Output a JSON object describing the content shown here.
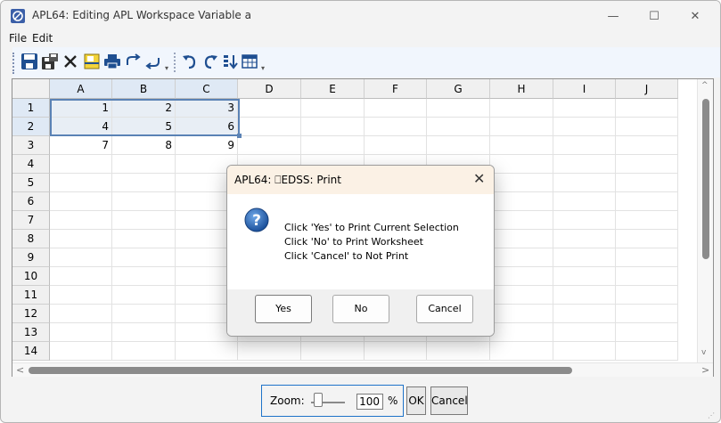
{
  "window": {
    "title": "APL64: Editing APL Workspace Variable a",
    "minimize_glyph": "—",
    "maximize_glyph": "☐",
    "close_glyph": "✕"
  },
  "menu": {
    "items": [
      "File",
      "Edit"
    ]
  },
  "toolbar": {
    "icons": [
      "save-icon",
      "save-as-icon",
      "close-icon",
      "split-icon",
      "print-icon",
      "redo-arrow-icon",
      "undo-arrow-icon",
      "undo-icon",
      "redo-icon",
      "sort-icon",
      "table-icon"
    ]
  },
  "grid": {
    "columns": [
      "A",
      "B",
      "C",
      "D",
      "E",
      "F",
      "G",
      "H",
      "I",
      "J"
    ],
    "rows": [
      "1",
      "2",
      "3",
      "4",
      "5",
      "6",
      "7",
      "8",
      "9",
      "10",
      "11",
      "12",
      "13",
      "14"
    ],
    "cells": [
      [
        "1",
        "2",
        "3"
      ],
      [
        "4",
        "5",
        "6"
      ],
      [
        "7",
        "8",
        "9"
      ]
    ],
    "selection": "A1:C2",
    "scroll_up": "^",
    "scroll_down": "v",
    "scroll_left": "<",
    "scroll_right": ">"
  },
  "dialog": {
    "title": "APL64: ⎕EDSS: Print",
    "close_glyph": "✕",
    "lines": [
      "Click 'Yes' to Print Current Selection",
      "Click 'No' to Print Worksheet",
      "Click 'Cancel' to Not Print"
    ],
    "icon": "question-icon",
    "buttons": {
      "yes": "Yes",
      "no": "No",
      "cancel": "Cancel"
    }
  },
  "zoom": {
    "label": "Zoom:",
    "value": "100",
    "unit": "%",
    "ok_label": "OK",
    "cancel_label": "Cancel"
  },
  "colors": {
    "accent": "#1e73c9",
    "selection_border": "#5a82b5",
    "dialog_title_bg": "#fbf1e5",
    "toolbar_bg": "#f1f6fd"
  }
}
